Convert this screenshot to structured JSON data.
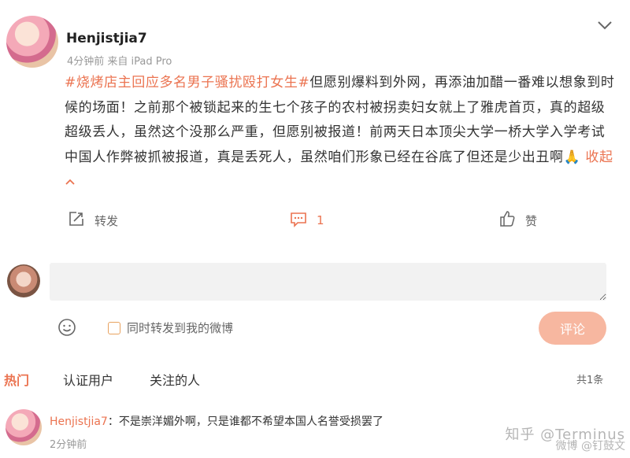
{
  "post": {
    "username": "Henjistjia7",
    "meta": "4分钟前  来自 iPad Pro",
    "hashtag": "#烧烤店主回应多名男子骚扰殴打女生#",
    "body": "但愿别爆料到外网，再添油加醋一番难以想象到时候的场面！之前那个被锁起来的生七个孩子的农村被拐卖妇女就上了雅虎首页，真的超级超级丢人，虽然这个没那么严重，但愿别被报道！前两天日本顶尖大学一桥大学入学考试中国人作弊被抓被报道，真是丢死人，虽然咱们形象已经在谷底了但还是少出丑啊",
    "emoji": "🙏",
    "collapse_label": "收起",
    "collapse_arrow": "^"
  },
  "actions": {
    "repost_label": "转发",
    "comment_count": "1",
    "like_label": "赞"
  },
  "composer": {
    "placeholder": "",
    "sync_label": "同时转发到我的微博",
    "submit_label": "评论"
  },
  "tabs": {
    "hot": "热门",
    "verified": "认证用户",
    "following": "关注的人",
    "count": "共1条"
  },
  "comments": [
    {
      "user": "Henjistjia7",
      "separator": "：",
      "text": "不是崇洋媚外啊，只是谁都不希望本国人名誉受损罢了",
      "time": "2分钟前"
    }
  ],
  "watermark": {
    "line1": "知乎 @Terminus",
    "line2": "微博 @钉鼓文"
  },
  "colors": {
    "accent": "#eb7350",
    "submit_bg": "#f7b7a0",
    "input_bg": "#f2f2f2"
  }
}
